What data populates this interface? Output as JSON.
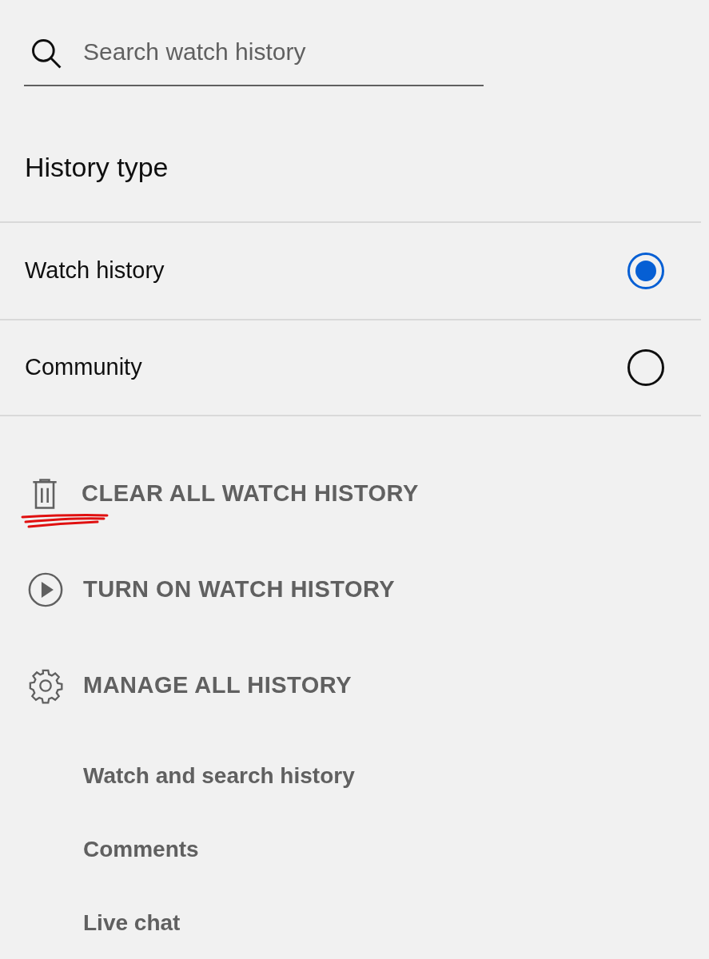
{
  "search": {
    "placeholder": "Search watch history"
  },
  "history_type": {
    "title": "History type",
    "options": [
      {
        "label": "Watch history",
        "selected": true
      },
      {
        "label": "Community",
        "selected": false
      }
    ]
  },
  "actions": [
    {
      "kind": "trash",
      "label": "CLEAR ALL WATCH HISTORY",
      "annotated": true
    },
    {
      "kind": "play",
      "label": "TURN ON WATCH HISTORY",
      "annotated": false
    },
    {
      "kind": "gear",
      "label": "MANAGE ALL HISTORY",
      "annotated": false
    }
  ],
  "manage_links": [
    "Watch and search history",
    "Comments",
    "Live chat"
  ]
}
